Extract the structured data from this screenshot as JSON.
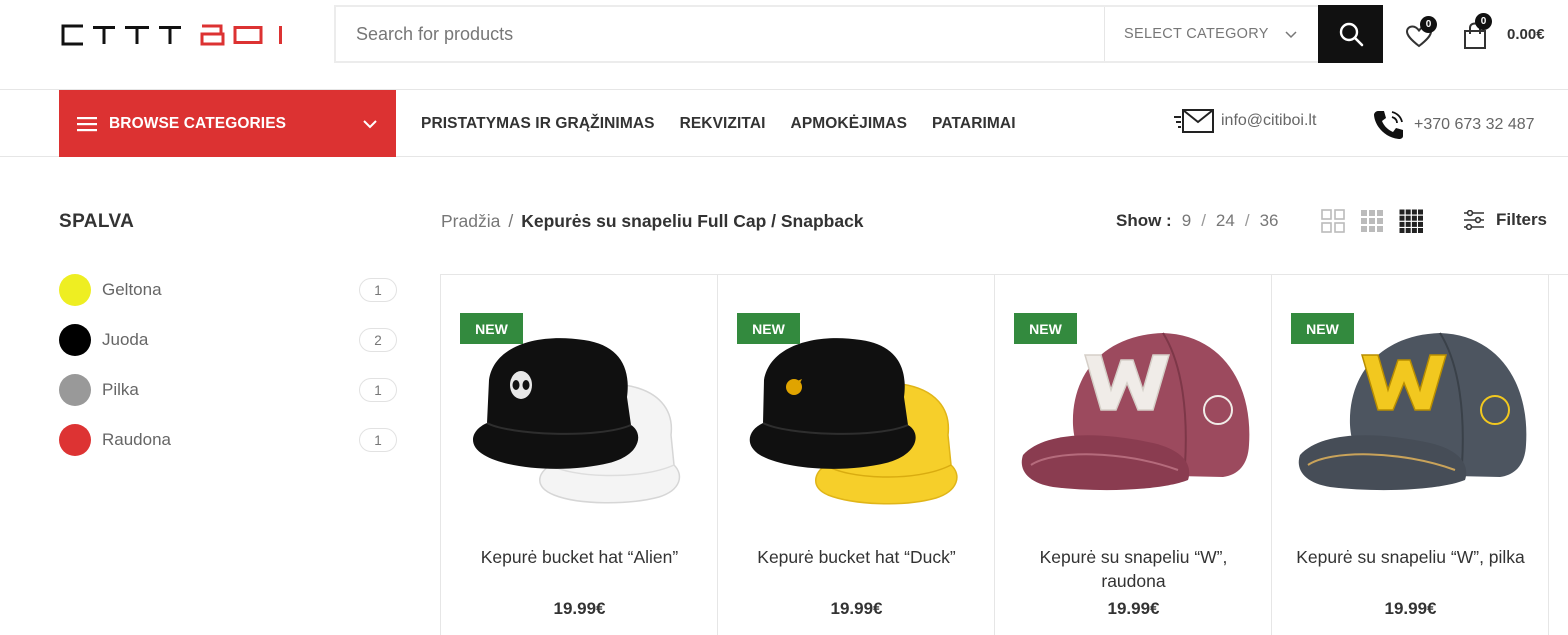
{
  "header": {
    "logo_text": "CITIBOI",
    "search_placeholder": "Search for products",
    "category_select": "SELECT CATEGORY",
    "wishlist_count": "0",
    "cart_count": "0",
    "cart_total": "0.00€"
  },
  "nav": {
    "browse_label": "BROWSE CATEGORIES",
    "links": [
      "PRISTATYMAS IR GRĄŽINIMAS",
      "REKVIZITAI",
      "APMOKĖJIMAS",
      "PATARIMAI"
    ],
    "email": "info@citiboi.lt",
    "phone": "+370 673 32 487"
  },
  "sidebar": {
    "title": "SPALVA",
    "colors": [
      {
        "name": "Geltona",
        "count": "1",
        "color": "#eeee22"
      },
      {
        "name": "Juoda",
        "count": "2",
        "color": "#000000"
      },
      {
        "name": "Pilka",
        "count": "1",
        "color": "#999999"
      },
      {
        "name": "Raudona",
        "count": "1",
        "color": "#dd3333"
      }
    ]
  },
  "toolbar": {
    "breadcrumb_home": "Pradžia",
    "breadcrumb_sep": "/",
    "breadcrumb_current": "Kepurės su snapeliu Full Cap / Snapback",
    "show_label": "Show :",
    "show_options": [
      "9",
      "24",
      "36"
    ],
    "filters_label": "Filters"
  },
  "products": [
    {
      "badge": "NEW",
      "name": "Kepurė bucket hat “Alien”",
      "price": "19.99€"
    },
    {
      "badge": "NEW",
      "name": "Kepurė bucket hat “Duck”",
      "price": "19.99€"
    },
    {
      "badge": "NEW",
      "name": "Kepurė su snapeliu “W”, raudona",
      "price": "19.99€"
    },
    {
      "badge": "NEW",
      "name": "Kepurė su snapeliu “W”, pilka",
      "price": "19.99€"
    }
  ],
  "colors": {
    "brand_red": "#dc3232",
    "badge_green": "#338a3e",
    "dark": "#111111"
  }
}
